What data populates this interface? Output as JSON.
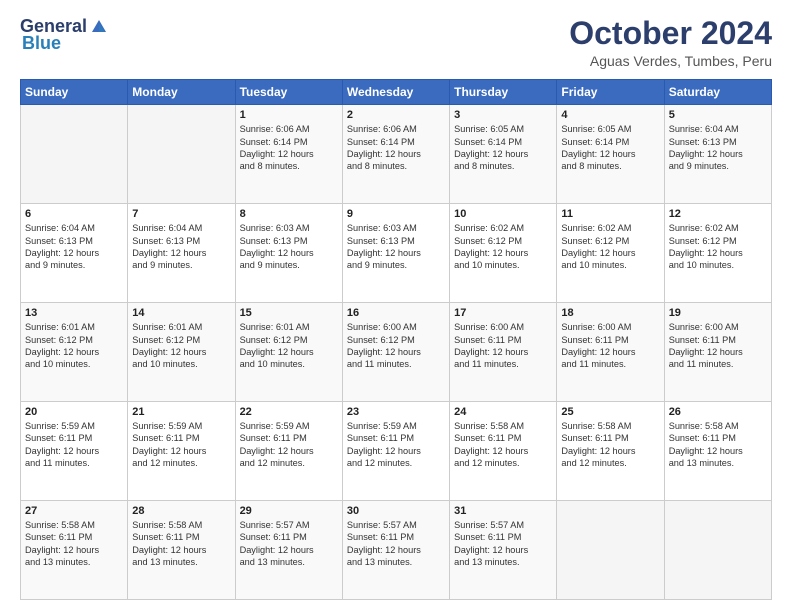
{
  "logo": {
    "general": "General",
    "blue": "Blue"
  },
  "header": {
    "title": "October 2024",
    "subtitle": "Aguas Verdes, Tumbes, Peru"
  },
  "days_of_week": [
    "Sunday",
    "Monday",
    "Tuesday",
    "Wednesday",
    "Thursday",
    "Friday",
    "Saturday"
  ],
  "weeks": [
    [
      {
        "day": "",
        "info": ""
      },
      {
        "day": "",
        "info": ""
      },
      {
        "day": "1",
        "info": "Sunrise: 6:06 AM\nSunset: 6:14 PM\nDaylight: 12 hours\nand 8 minutes."
      },
      {
        "day": "2",
        "info": "Sunrise: 6:06 AM\nSunset: 6:14 PM\nDaylight: 12 hours\nand 8 minutes."
      },
      {
        "day": "3",
        "info": "Sunrise: 6:05 AM\nSunset: 6:14 PM\nDaylight: 12 hours\nand 8 minutes."
      },
      {
        "day": "4",
        "info": "Sunrise: 6:05 AM\nSunset: 6:14 PM\nDaylight: 12 hours\nand 8 minutes."
      },
      {
        "day": "5",
        "info": "Sunrise: 6:04 AM\nSunset: 6:13 PM\nDaylight: 12 hours\nand 9 minutes."
      }
    ],
    [
      {
        "day": "6",
        "info": "Sunrise: 6:04 AM\nSunset: 6:13 PM\nDaylight: 12 hours\nand 9 minutes."
      },
      {
        "day": "7",
        "info": "Sunrise: 6:04 AM\nSunset: 6:13 PM\nDaylight: 12 hours\nand 9 minutes."
      },
      {
        "day": "8",
        "info": "Sunrise: 6:03 AM\nSunset: 6:13 PM\nDaylight: 12 hours\nand 9 minutes."
      },
      {
        "day": "9",
        "info": "Sunrise: 6:03 AM\nSunset: 6:13 PM\nDaylight: 12 hours\nand 9 minutes."
      },
      {
        "day": "10",
        "info": "Sunrise: 6:02 AM\nSunset: 6:12 PM\nDaylight: 12 hours\nand 10 minutes."
      },
      {
        "day": "11",
        "info": "Sunrise: 6:02 AM\nSunset: 6:12 PM\nDaylight: 12 hours\nand 10 minutes."
      },
      {
        "day": "12",
        "info": "Sunrise: 6:02 AM\nSunset: 6:12 PM\nDaylight: 12 hours\nand 10 minutes."
      }
    ],
    [
      {
        "day": "13",
        "info": "Sunrise: 6:01 AM\nSunset: 6:12 PM\nDaylight: 12 hours\nand 10 minutes."
      },
      {
        "day": "14",
        "info": "Sunrise: 6:01 AM\nSunset: 6:12 PM\nDaylight: 12 hours\nand 10 minutes."
      },
      {
        "day": "15",
        "info": "Sunrise: 6:01 AM\nSunset: 6:12 PM\nDaylight: 12 hours\nand 10 minutes."
      },
      {
        "day": "16",
        "info": "Sunrise: 6:00 AM\nSunset: 6:12 PM\nDaylight: 12 hours\nand 11 minutes."
      },
      {
        "day": "17",
        "info": "Sunrise: 6:00 AM\nSunset: 6:11 PM\nDaylight: 12 hours\nand 11 minutes."
      },
      {
        "day": "18",
        "info": "Sunrise: 6:00 AM\nSunset: 6:11 PM\nDaylight: 12 hours\nand 11 minutes."
      },
      {
        "day": "19",
        "info": "Sunrise: 6:00 AM\nSunset: 6:11 PM\nDaylight: 12 hours\nand 11 minutes."
      }
    ],
    [
      {
        "day": "20",
        "info": "Sunrise: 5:59 AM\nSunset: 6:11 PM\nDaylight: 12 hours\nand 11 minutes."
      },
      {
        "day": "21",
        "info": "Sunrise: 5:59 AM\nSunset: 6:11 PM\nDaylight: 12 hours\nand 12 minutes."
      },
      {
        "day": "22",
        "info": "Sunrise: 5:59 AM\nSunset: 6:11 PM\nDaylight: 12 hours\nand 12 minutes."
      },
      {
        "day": "23",
        "info": "Sunrise: 5:59 AM\nSunset: 6:11 PM\nDaylight: 12 hours\nand 12 minutes."
      },
      {
        "day": "24",
        "info": "Sunrise: 5:58 AM\nSunset: 6:11 PM\nDaylight: 12 hours\nand 12 minutes."
      },
      {
        "day": "25",
        "info": "Sunrise: 5:58 AM\nSunset: 6:11 PM\nDaylight: 12 hours\nand 12 minutes."
      },
      {
        "day": "26",
        "info": "Sunrise: 5:58 AM\nSunset: 6:11 PM\nDaylight: 12 hours\nand 13 minutes."
      }
    ],
    [
      {
        "day": "27",
        "info": "Sunrise: 5:58 AM\nSunset: 6:11 PM\nDaylight: 12 hours\nand 13 minutes."
      },
      {
        "day": "28",
        "info": "Sunrise: 5:58 AM\nSunset: 6:11 PM\nDaylight: 12 hours\nand 13 minutes."
      },
      {
        "day": "29",
        "info": "Sunrise: 5:57 AM\nSunset: 6:11 PM\nDaylight: 12 hours\nand 13 minutes."
      },
      {
        "day": "30",
        "info": "Sunrise: 5:57 AM\nSunset: 6:11 PM\nDaylight: 12 hours\nand 13 minutes."
      },
      {
        "day": "31",
        "info": "Sunrise: 5:57 AM\nSunset: 6:11 PM\nDaylight: 12 hours\nand 13 minutes."
      },
      {
        "day": "",
        "info": ""
      },
      {
        "day": "",
        "info": ""
      }
    ]
  ]
}
